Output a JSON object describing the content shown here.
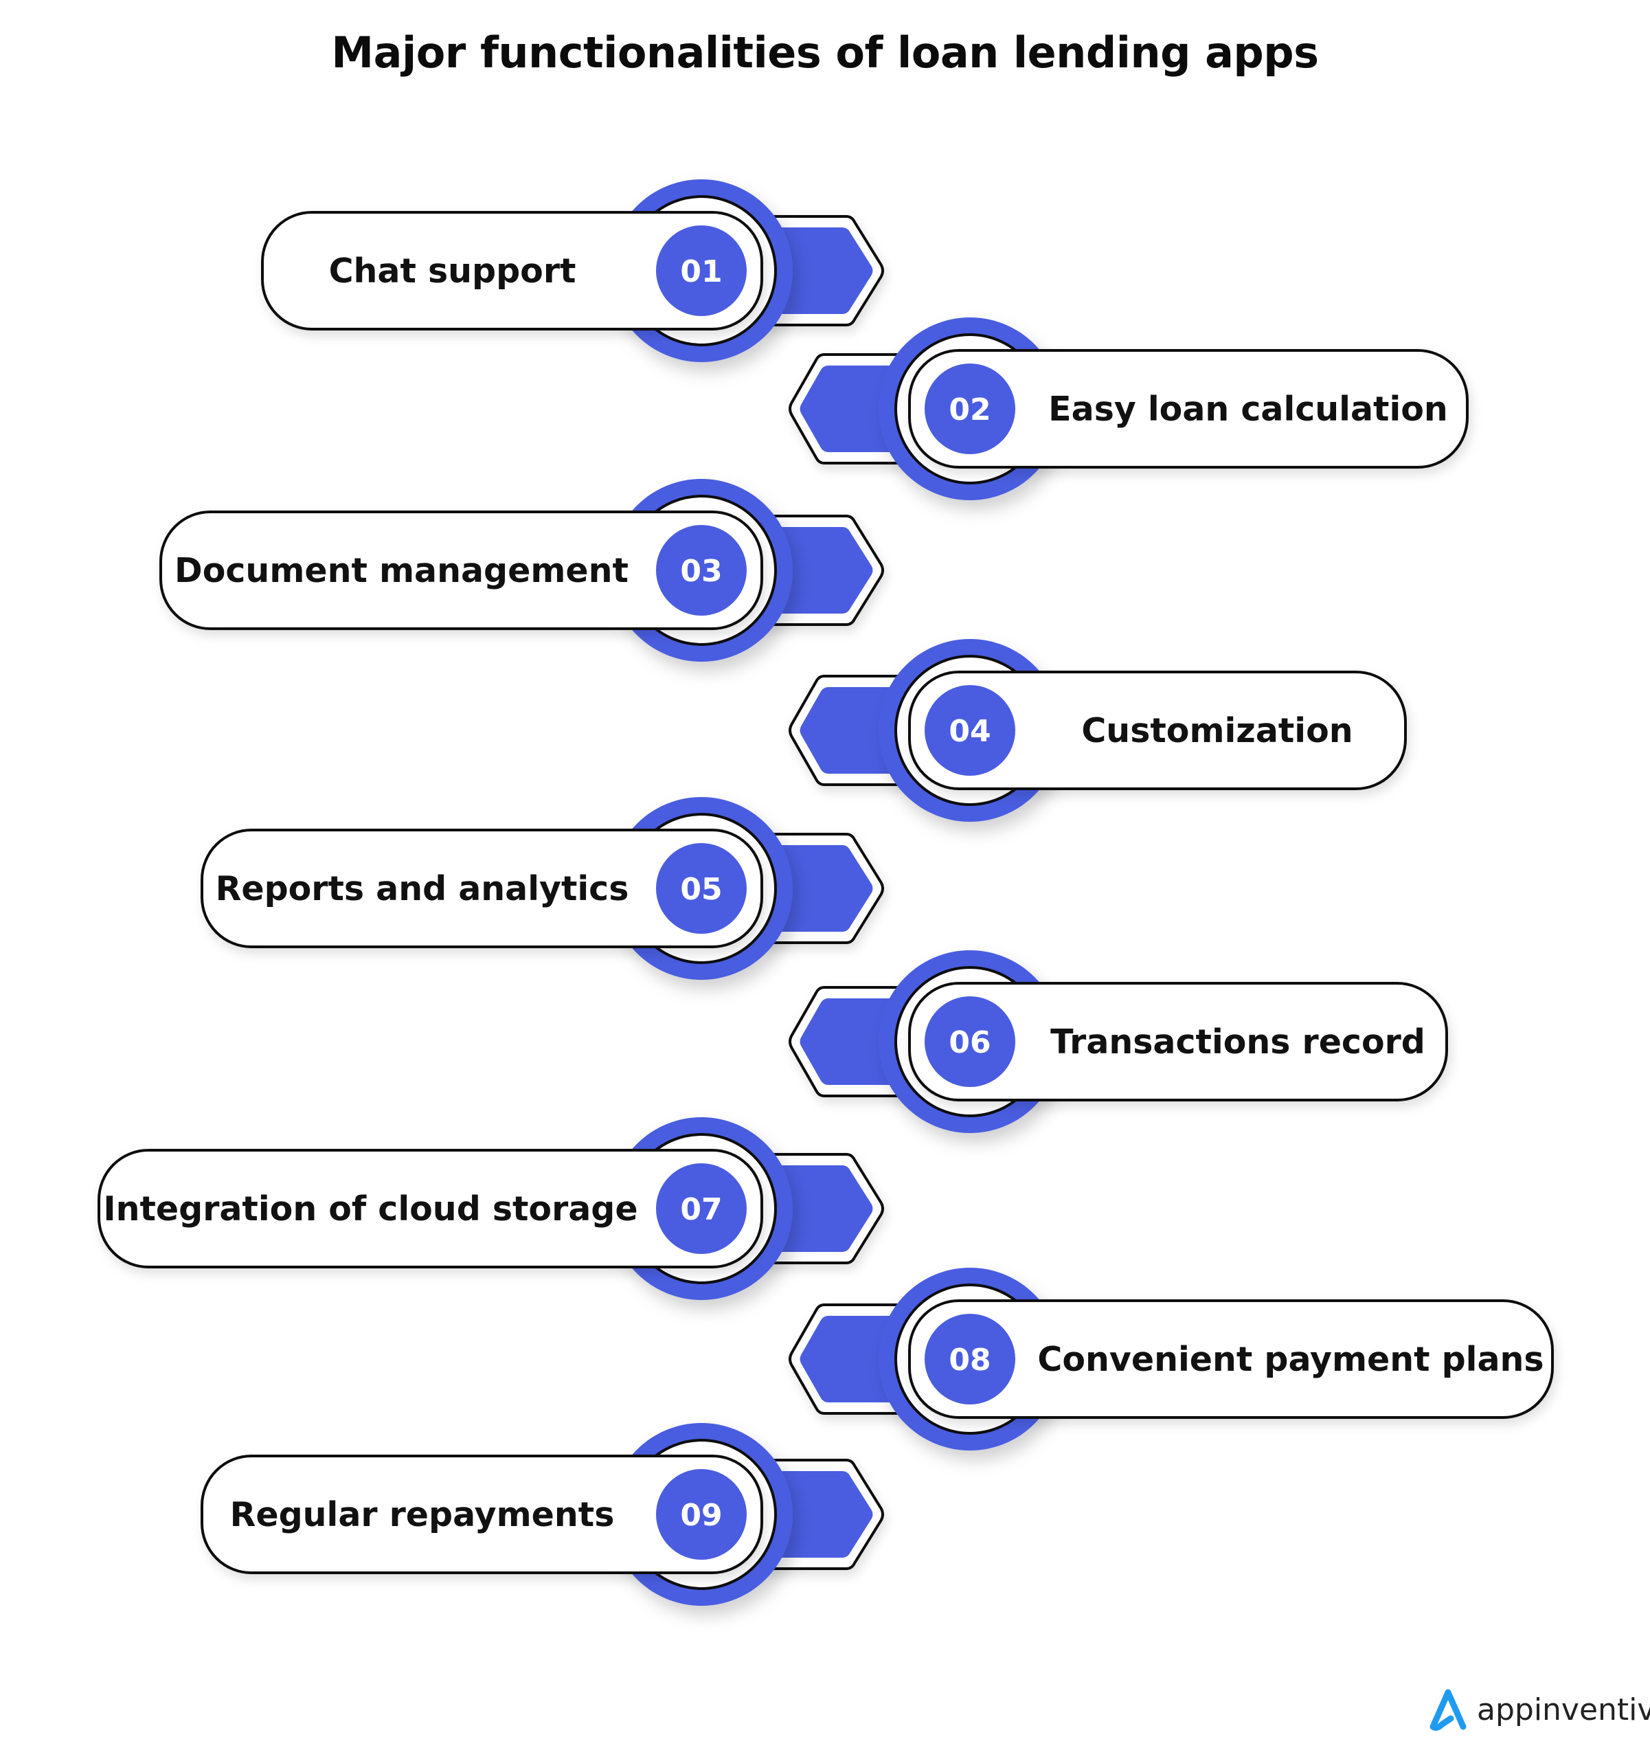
{
  "title": "Major functionalities of loan lending apps",
  "colors": {
    "accent": "#4A5DE0",
    "outline": "#0d0d0d",
    "text": "#111111",
    "logo_blue": "#1E9BF0"
  },
  "items": [
    {
      "number": "01",
      "label": "Chat support",
      "side": "left"
    },
    {
      "number": "02",
      "label": "Easy loan calculation",
      "side": "right"
    },
    {
      "number": "03",
      "label": "Document management",
      "side": "left"
    },
    {
      "number": "04",
      "label": "Customization",
      "side": "right"
    },
    {
      "number": "05",
      "label": "Reports and analytics",
      "side": "left"
    },
    {
      "number": "06",
      "label": "Transactions record",
      "side": "right"
    },
    {
      "number": "07",
      "label": "Integration of cloud storage",
      "side": "left"
    },
    {
      "number": "08",
      "label": "Convenient payment plans",
      "side": "right"
    },
    {
      "number": "09",
      "label": "Regular repayments",
      "side": "left"
    }
  ],
  "logo": {
    "icon": "appinventiv-a-logo-icon",
    "text": "appinventiv"
  }
}
